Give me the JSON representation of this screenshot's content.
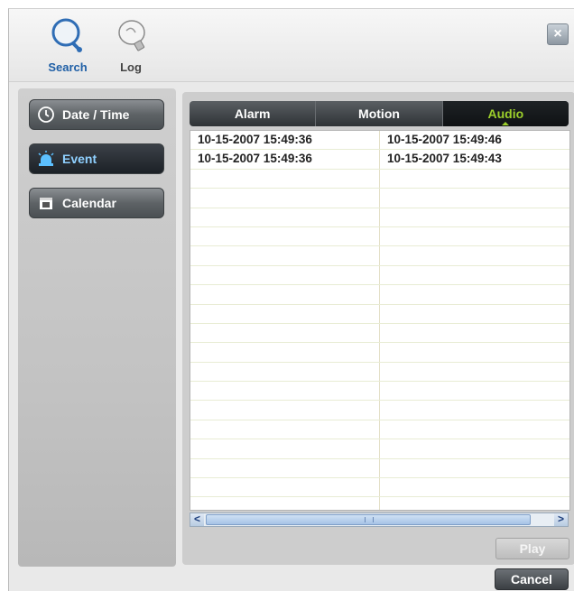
{
  "toolbar": {
    "search_label": "Search",
    "log_label": "Log",
    "close_glyph": "×"
  },
  "sidebar": {
    "items": [
      {
        "label": "Date / Time",
        "icon": "clock-icon"
      },
      {
        "label": "Event",
        "icon": "siren-icon",
        "active": true
      },
      {
        "label": "Calendar",
        "icon": "calendar-icon"
      }
    ]
  },
  "tabs": [
    {
      "label": "Alarm"
    },
    {
      "label": "Motion"
    },
    {
      "label": "Audio",
      "active": true
    }
  ],
  "events": [
    {
      "start": "10-15-2007 15:49:36",
      "end": "10-15-2007 15:49:46"
    },
    {
      "start": "10-15-2007 15:49:36",
      "end": "10-15-2007 15:49:43"
    }
  ],
  "buttons": {
    "play": "Play",
    "cancel": "Cancel"
  },
  "colors": {
    "active_tab_text": "#9ccf2b",
    "search_label": "#1f5fa6"
  }
}
